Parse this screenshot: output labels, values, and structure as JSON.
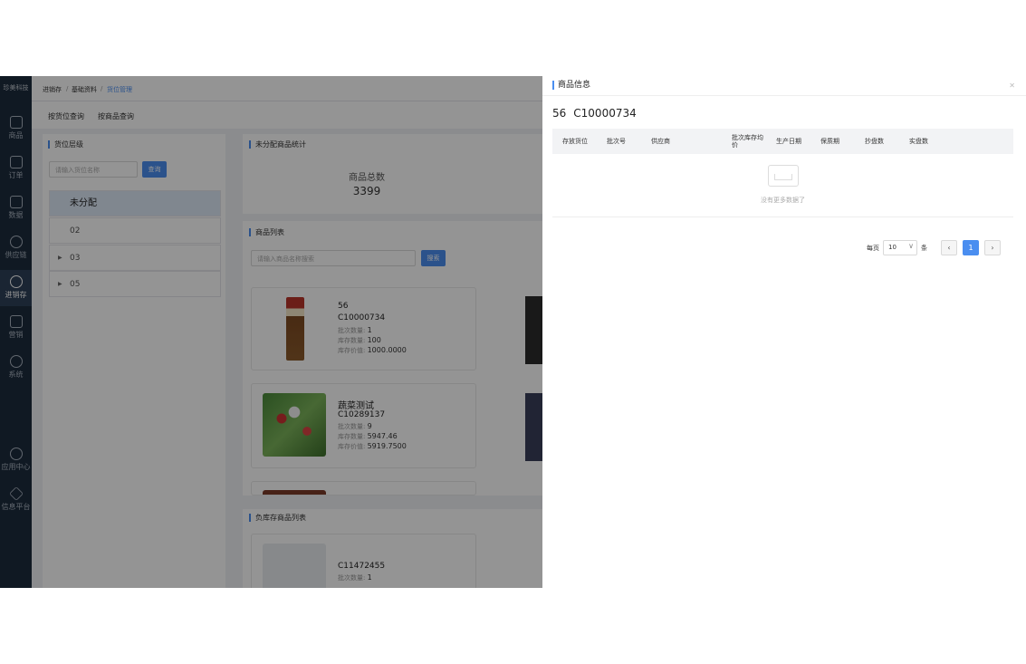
{
  "sidebar": {
    "brand": "珍美科技",
    "items": [
      {
        "label": "商品",
        "icon": "shop-icon"
      },
      {
        "label": "订单",
        "icon": "order-icon"
      },
      {
        "label": "数据",
        "icon": "chart-icon"
      },
      {
        "label": "供应链",
        "icon": "supply-icon"
      },
      {
        "label": "进销存",
        "icon": "inventory-icon"
      },
      {
        "label": "营销",
        "icon": "tag-icon"
      },
      {
        "label": "系统",
        "icon": "gear-icon"
      },
      {
        "label": "应用中心",
        "icon": "apps-icon"
      },
      {
        "label": "信息平台",
        "icon": "cube-icon"
      }
    ]
  },
  "breadcrumb": {
    "level1": "进销存",
    "level2": "基础资料",
    "current": "货位管理"
  },
  "subtabs": {
    "by_location": "按货位查询",
    "by_product": "按商品查询"
  },
  "location_panel": {
    "title": "货位层级",
    "search_placeholder": "请输入货位名称",
    "search_button": "查询",
    "rows": [
      "未分配",
      "02",
      "03",
      "05"
    ]
  },
  "stats_panel": {
    "title": "未分配商品统计",
    "total_label": "商品总数",
    "total_value": "3399"
  },
  "product_list": {
    "title": "商品列表",
    "search_placeholder": "请输入商品名称搜索",
    "search_button": "搜索",
    "cards": [
      {
        "name": "56",
        "code": "C10000734",
        "batch_label": "批次数量:",
        "batch": "1",
        "stock_label": "库存数量:",
        "stock": "100",
        "value_label": "库存价值:",
        "value": "1000.0000"
      },
      {
        "name": "蔬菜测试",
        "code": "C10289137",
        "batch_label": "批次数量:",
        "batch": "9",
        "stock_label": "库存数量:",
        "stock": "5947.46",
        "value_label": "库存价值:",
        "value": "5919.7500"
      }
    ]
  },
  "negative_list": {
    "title": "负库存商品列表",
    "cards": [
      {
        "code": "C11472455",
        "batch_label": "批次数量:",
        "batch": "1"
      }
    ]
  },
  "drawer": {
    "title": "商品信息",
    "product_name": "56",
    "product_code": "C10000734",
    "columns": [
      "存放货位",
      "批次号",
      "供应商",
      "批次库存均价",
      "生产日期",
      "保质期",
      "抄盘数",
      "实盘数"
    ],
    "empty_text": "没有更多数据了",
    "pagination": {
      "per_page_label": "每页",
      "per_page_value": "10",
      "unit_label": "条",
      "prev": "‹",
      "current_page": "1",
      "next": "›"
    }
  }
}
